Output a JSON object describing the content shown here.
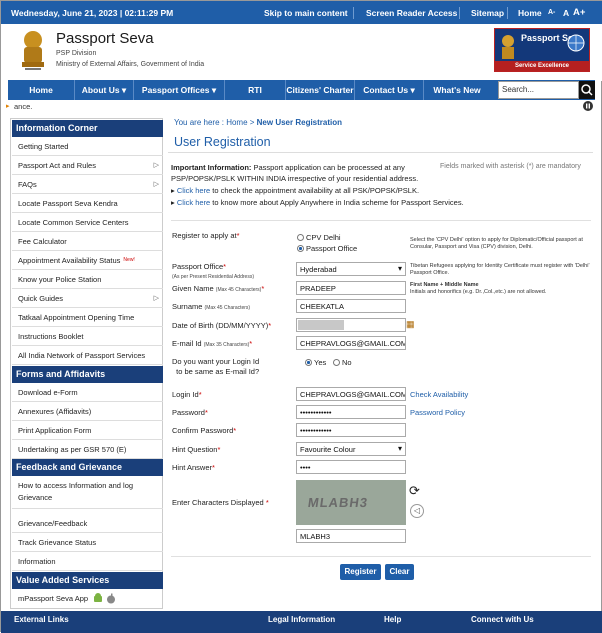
{
  "topbar": {
    "date": "Wednesday,  June  21, 2023 | 02:11:29 PM",
    "skip": "Skip to main content",
    "reader": "Screen Reader Access",
    "sitemap": "Sitemap",
    "home": "Home",
    "font_small": "A-",
    "font_normal": "A",
    "font_large": "A+"
  },
  "header": {
    "title": "Passport Seva",
    "division": "PSP Division",
    "ministry": "Ministry of External Affairs, Government of India",
    "logo_text": "Passport Seva",
    "logo_tagline": "Service Excellence"
  },
  "nav": {
    "items": [
      "Home",
      "About Us ▾",
      "Passport Offices ▾",
      "RTI",
      "Citizens' Charter",
      "Contact Us ▾",
      "What's New"
    ],
    "search_placeholder": "Search..."
  },
  "ticker": {
    "text": "ance."
  },
  "sidebar": {
    "info_heading": "Information Corner",
    "info_items": [
      {
        "label": "Getting Started",
        "chev": ""
      },
      {
        "label": "Passport Act and Rules",
        "chev": "▷"
      },
      {
        "label": "FAQs",
        "chev": "▷"
      },
      {
        "label": "Locate Passport Seva Kendra",
        "chev": ""
      },
      {
        "label": "Locate Common Service Centers",
        "chev": ""
      },
      {
        "label": "Fee Calculator",
        "chev": ""
      },
      {
        "label": "Appointment Availability Status",
        "chev": ""
      },
      {
        "label": "Know your Police Station",
        "chev": ""
      },
      {
        "label": "Quick Guides",
        "chev": "▷"
      },
      {
        "label": "Tatkaal Appointment Opening Time",
        "chev": ""
      },
      {
        "label": "Instructions Booklet",
        "chev": ""
      },
      {
        "label": "All India Network of Passport Services",
        "chev": ""
      }
    ],
    "new_badge": "New!",
    "forms_heading": "Forms and Affidavits",
    "forms_items": [
      "Download e-Form",
      "Annexures (Affidavits)",
      "Print Application Form",
      "Undertaking as per GSR 570 (E)"
    ],
    "feedback_heading": "Feedback and Grievance",
    "feedback_items": [
      "How to access Information and log Grievance",
      "Grievance/Feedback",
      "Track Grievance Status",
      "Information"
    ],
    "vas_heading": "Value Added Services",
    "vas_items": [
      "mPassport Seva App"
    ]
  },
  "breadcrumb": {
    "prefix": "You are here : ",
    "home": "Home",
    "sep": " > ",
    "current": "New User Registration"
  },
  "page_title": "User Registration",
  "info": {
    "bold": "Important Information:",
    "text": " Passport application can be processed at any PSP/POPSK/PSLK WITHIN INDIA irrespective of your residential address.",
    "mandatory": "Fields marked with asterisk (*) are mandatory",
    "link1": "Click here",
    "link1_rest": " to check the appointment availability at all PSK/POPSK/PSLK.",
    "link2": "Click here",
    "link2_rest": " to know more about Apply Anywhere in India scheme for Passport Services."
  },
  "form": {
    "register_label": "Register to apply at",
    "opt_cpv": "CPV Delhi",
    "opt_po": "Passport Office",
    "cpv_note": "Select the 'CPV Delhi' option to apply for Diplomatic/Official passport at Consular, Passport and Visa (CPV) division, Delhi.",
    "po_label": "Passport Office",
    "po_sub": "(As per Present Residential Address)",
    "po_value": "Hyderabad",
    "po_note": "Tibetan Refugees applying for Identity Certificate must register with 'Delhi' Passport Office.",
    "given_label": "Given Name",
    "given_sub": "(Max 45 Characters)",
    "given_value": "PRADEEP",
    "given_note_bold": "First Name + Middle Name",
    "given_note": "Initials and honorifics (e.g. Dr.,Col.,etc.) are not allowed.",
    "surname_label": "Surname",
    "surname_sub": "(Max 45 Characters)",
    "surname_value": "CHEEKATLA",
    "dob_label": "Date of Birth (DD/MM/YYYY)",
    "email_label": "E-mail Id",
    "email_sub": "(Max 35 Characters)",
    "email_value": "CHEPRAVLOGS@GMAIL.COM",
    "same_label_1": "Do you want your Login Id",
    "same_label_2": "to be same as E-mail Id?",
    "yes": "Yes",
    "no": "No",
    "login_label": "Login Id",
    "login_value": "CHEPRAVLOGS@GMAIL.COM",
    "check": "Check Availability",
    "password_label": "Password",
    "password_value": "••••••••••••",
    "policy": "Password Policy",
    "confirm_label": "Confirm Password",
    "confirm_value": "••••••••••••",
    "hint_q_label": "Hint Question",
    "hint_q_value": "Favourite Colour",
    "hint_a_label": "Hint Answer",
    "hint_a_value": "••••",
    "captcha_label": "Enter Characters Displayed",
    "captcha_text": "MLABH3",
    "captcha_value": "MLABH3",
    "register_btn": "Register",
    "clear_btn": "Clear"
  },
  "footer": {
    "items": [
      "External Links",
      "Legal Information",
      "Help",
      "Connect with Us"
    ]
  }
}
